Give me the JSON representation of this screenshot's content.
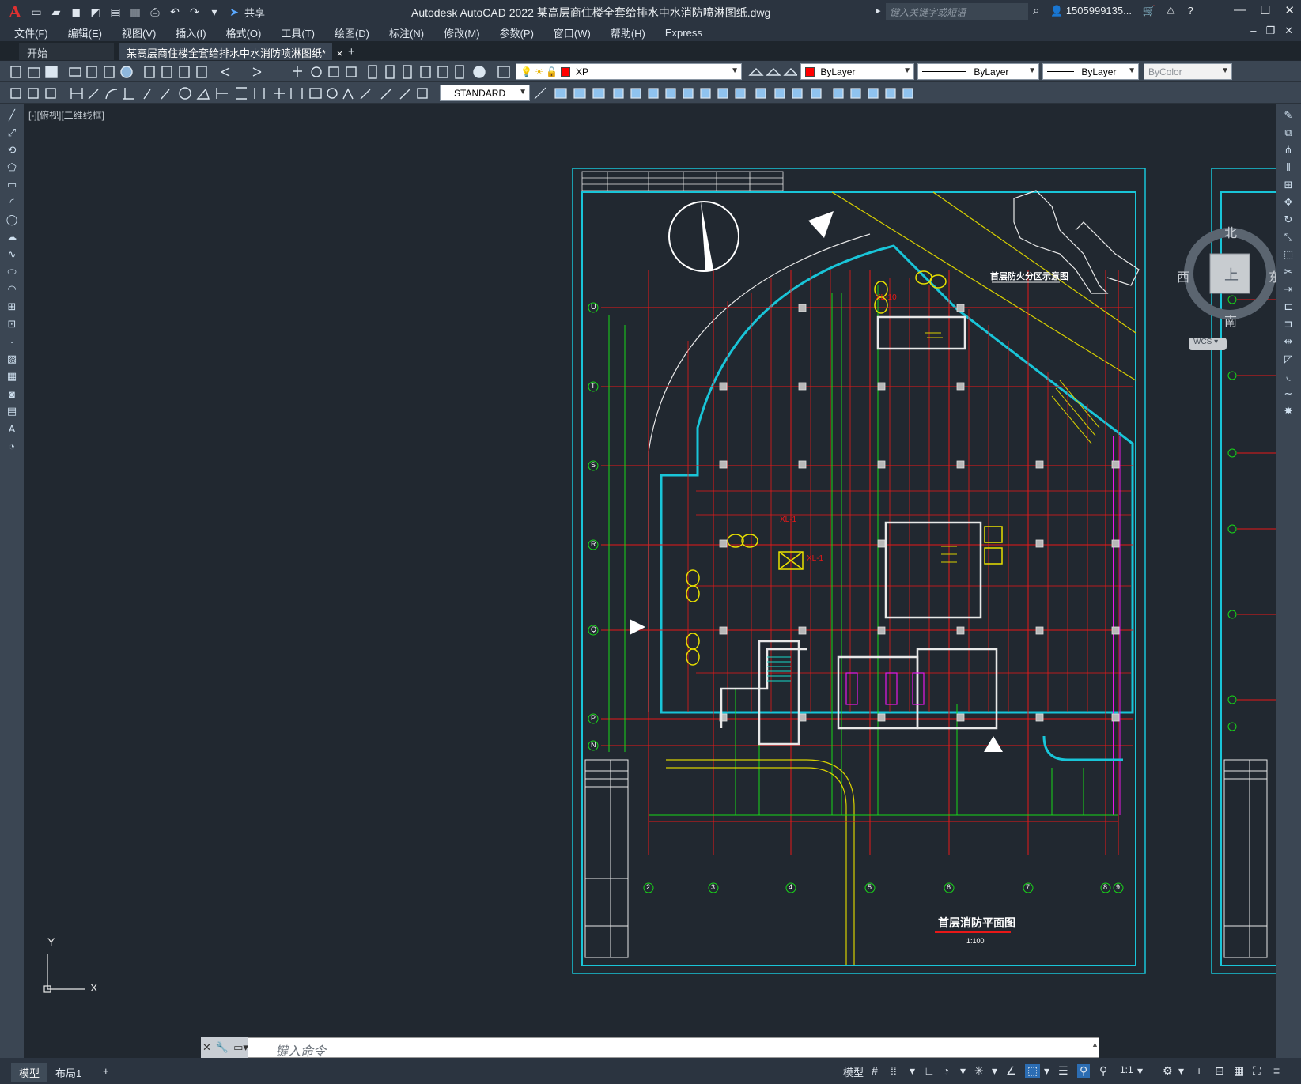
{
  "app": {
    "logo": "A",
    "title": "Autodesk AutoCAD 2022     某高层商住楼全套给排水中水消防喷淋图纸.dwg",
    "share_label": "共享",
    "search_placeholder": "键入关键字或短语",
    "user_name": "1505999135...",
    "window_controls": [
      "minimize-icon",
      "maximize-icon",
      "close-icon"
    ]
  },
  "menubar": {
    "items": [
      "文件(F)",
      "编辑(E)",
      "视图(V)",
      "插入(I)",
      "格式(O)",
      "工具(T)",
      "绘图(D)",
      "标注(N)",
      "修改(M)",
      "参数(P)",
      "窗口(W)",
      "帮助(H)",
      "Express"
    ]
  },
  "tabs": {
    "start": "开始",
    "drawing": "某高层商住楼全套给排水中水消防喷淋图纸*",
    "close": "×",
    "add": "+"
  },
  "toolbar": {
    "layer_name": "XP",
    "color_combo": "ByLayer",
    "linetype_combo": "ByLayer",
    "lineweight_combo": "ByLayer",
    "plotstyle_combo": "ByColor",
    "textstyle_combo": "STANDARD",
    "layer_color": "#ff0000"
  },
  "canvas": {
    "view_label": "[-][俯视][二维线框]",
    "viewcube": {
      "north": "北",
      "south": "南",
      "east": "东",
      "west": "西",
      "face": "上",
      "wcs": "WCS"
    },
    "ucs": {
      "x": "X",
      "y": "Y"
    },
    "drawing_title": "首层消防平面图",
    "drawing_scale": "1:100",
    "inset_title": "首层防火分区示意图",
    "grid_rows": [
      "U",
      "T",
      "S",
      "R",
      "Q",
      "P",
      "N"
    ],
    "grid_cols": [
      "2",
      "3",
      "4",
      "5",
      "6",
      "7",
      "8",
      "9"
    ],
    "annotations": [
      "XL-10",
      "XL-1",
      "XL-1"
    ]
  },
  "cmdline": {
    "placeholder": "键入命令"
  },
  "statusbar": {
    "tabs": [
      "模型",
      "布局1",
      "+"
    ],
    "model_label": "模型",
    "scale": "1:1"
  }
}
